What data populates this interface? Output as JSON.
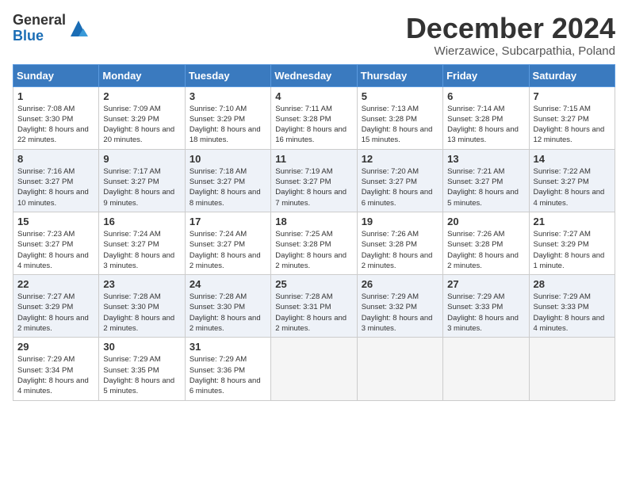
{
  "header": {
    "logo_general": "General",
    "logo_blue": "Blue",
    "month_title": "December 2024",
    "location": "Wierzawice, Subcarpathia, Poland"
  },
  "days_of_week": [
    "Sunday",
    "Monday",
    "Tuesday",
    "Wednesday",
    "Thursday",
    "Friday",
    "Saturday"
  ],
  "weeks": [
    [
      {
        "day": "1",
        "sunrise": "Sunrise: 7:08 AM",
        "sunset": "Sunset: 3:30 PM",
        "daylight": "Daylight: 8 hours and 22 minutes."
      },
      {
        "day": "2",
        "sunrise": "Sunrise: 7:09 AM",
        "sunset": "Sunset: 3:29 PM",
        "daylight": "Daylight: 8 hours and 20 minutes."
      },
      {
        "day": "3",
        "sunrise": "Sunrise: 7:10 AM",
        "sunset": "Sunset: 3:29 PM",
        "daylight": "Daylight: 8 hours and 18 minutes."
      },
      {
        "day": "4",
        "sunrise": "Sunrise: 7:11 AM",
        "sunset": "Sunset: 3:28 PM",
        "daylight": "Daylight: 8 hours and 16 minutes."
      },
      {
        "day": "5",
        "sunrise": "Sunrise: 7:13 AM",
        "sunset": "Sunset: 3:28 PM",
        "daylight": "Daylight: 8 hours and 15 minutes."
      },
      {
        "day": "6",
        "sunrise": "Sunrise: 7:14 AM",
        "sunset": "Sunset: 3:28 PM",
        "daylight": "Daylight: 8 hours and 13 minutes."
      },
      {
        "day": "7",
        "sunrise": "Sunrise: 7:15 AM",
        "sunset": "Sunset: 3:27 PM",
        "daylight": "Daylight: 8 hours and 12 minutes."
      }
    ],
    [
      {
        "day": "8",
        "sunrise": "Sunrise: 7:16 AM",
        "sunset": "Sunset: 3:27 PM",
        "daylight": "Daylight: 8 hours and 10 minutes."
      },
      {
        "day": "9",
        "sunrise": "Sunrise: 7:17 AM",
        "sunset": "Sunset: 3:27 PM",
        "daylight": "Daylight: 8 hours and 9 minutes."
      },
      {
        "day": "10",
        "sunrise": "Sunrise: 7:18 AM",
        "sunset": "Sunset: 3:27 PM",
        "daylight": "Daylight: 8 hours and 8 minutes."
      },
      {
        "day": "11",
        "sunrise": "Sunrise: 7:19 AM",
        "sunset": "Sunset: 3:27 PM",
        "daylight": "Daylight: 8 hours and 7 minutes."
      },
      {
        "day": "12",
        "sunrise": "Sunrise: 7:20 AM",
        "sunset": "Sunset: 3:27 PM",
        "daylight": "Daylight: 8 hours and 6 minutes."
      },
      {
        "day": "13",
        "sunrise": "Sunrise: 7:21 AM",
        "sunset": "Sunset: 3:27 PM",
        "daylight": "Daylight: 8 hours and 5 minutes."
      },
      {
        "day": "14",
        "sunrise": "Sunrise: 7:22 AM",
        "sunset": "Sunset: 3:27 PM",
        "daylight": "Daylight: 8 hours and 4 minutes."
      }
    ],
    [
      {
        "day": "15",
        "sunrise": "Sunrise: 7:23 AM",
        "sunset": "Sunset: 3:27 PM",
        "daylight": "Daylight: 8 hours and 4 minutes."
      },
      {
        "day": "16",
        "sunrise": "Sunrise: 7:24 AM",
        "sunset": "Sunset: 3:27 PM",
        "daylight": "Daylight: 8 hours and 3 minutes."
      },
      {
        "day": "17",
        "sunrise": "Sunrise: 7:24 AM",
        "sunset": "Sunset: 3:27 PM",
        "daylight": "Daylight: 8 hours and 2 minutes."
      },
      {
        "day": "18",
        "sunrise": "Sunrise: 7:25 AM",
        "sunset": "Sunset: 3:28 PM",
        "daylight": "Daylight: 8 hours and 2 minutes."
      },
      {
        "day": "19",
        "sunrise": "Sunrise: 7:26 AM",
        "sunset": "Sunset: 3:28 PM",
        "daylight": "Daylight: 8 hours and 2 minutes."
      },
      {
        "day": "20",
        "sunrise": "Sunrise: 7:26 AM",
        "sunset": "Sunset: 3:28 PM",
        "daylight": "Daylight: 8 hours and 2 minutes."
      },
      {
        "day": "21",
        "sunrise": "Sunrise: 7:27 AM",
        "sunset": "Sunset: 3:29 PM",
        "daylight": "Daylight: 8 hours and 1 minute."
      }
    ],
    [
      {
        "day": "22",
        "sunrise": "Sunrise: 7:27 AM",
        "sunset": "Sunset: 3:29 PM",
        "daylight": "Daylight: 8 hours and 2 minutes."
      },
      {
        "day": "23",
        "sunrise": "Sunrise: 7:28 AM",
        "sunset": "Sunset: 3:30 PM",
        "daylight": "Daylight: 8 hours and 2 minutes."
      },
      {
        "day": "24",
        "sunrise": "Sunrise: 7:28 AM",
        "sunset": "Sunset: 3:30 PM",
        "daylight": "Daylight: 8 hours and 2 minutes."
      },
      {
        "day": "25",
        "sunrise": "Sunrise: 7:28 AM",
        "sunset": "Sunset: 3:31 PM",
        "daylight": "Daylight: 8 hours and 2 minutes."
      },
      {
        "day": "26",
        "sunrise": "Sunrise: 7:29 AM",
        "sunset": "Sunset: 3:32 PM",
        "daylight": "Daylight: 8 hours and 3 minutes."
      },
      {
        "day": "27",
        "sunrise": "Sunrise: 7:29 AM",
        "sunset": "Sunset: 3:33 PM",
        "daylight": "Daylight: 8 hours and 3 minutes."
      },
      {
        "day": "28",
        "sunrise": "Sunrise: 7:29 AM",
        "sunset": "Sunset: 3:33 PM",
        "daylight": "Daylight: 8 hours and 4 minutes."
      }
    ],
    [
      {
        "day": "29",
        "sunrise": "Sunrise: 7:29 AM",
        "sunset": "Sunset: 3:34 PM",
        "daylight": "Daylight: 8 hours and 4 minutes."
      },
      {
        "day": "30",
        "sunrise": "Sunrise: 7:29 AM",
        "sunset": "Sunset: 3:35 PM",
        "daylight": "Daylight: 8 hours and 5 minutes."
      },
      {
        "day": "31",
        "sunrise": "Sunrise: 7:29 AM",
        "sunset": "Sunset: 3:36 PM",
        "daylight": "Daylight: 8 hours and 6 minutes."
      },
      null,
      null,
      null,
      null
    ]
  ]
}
